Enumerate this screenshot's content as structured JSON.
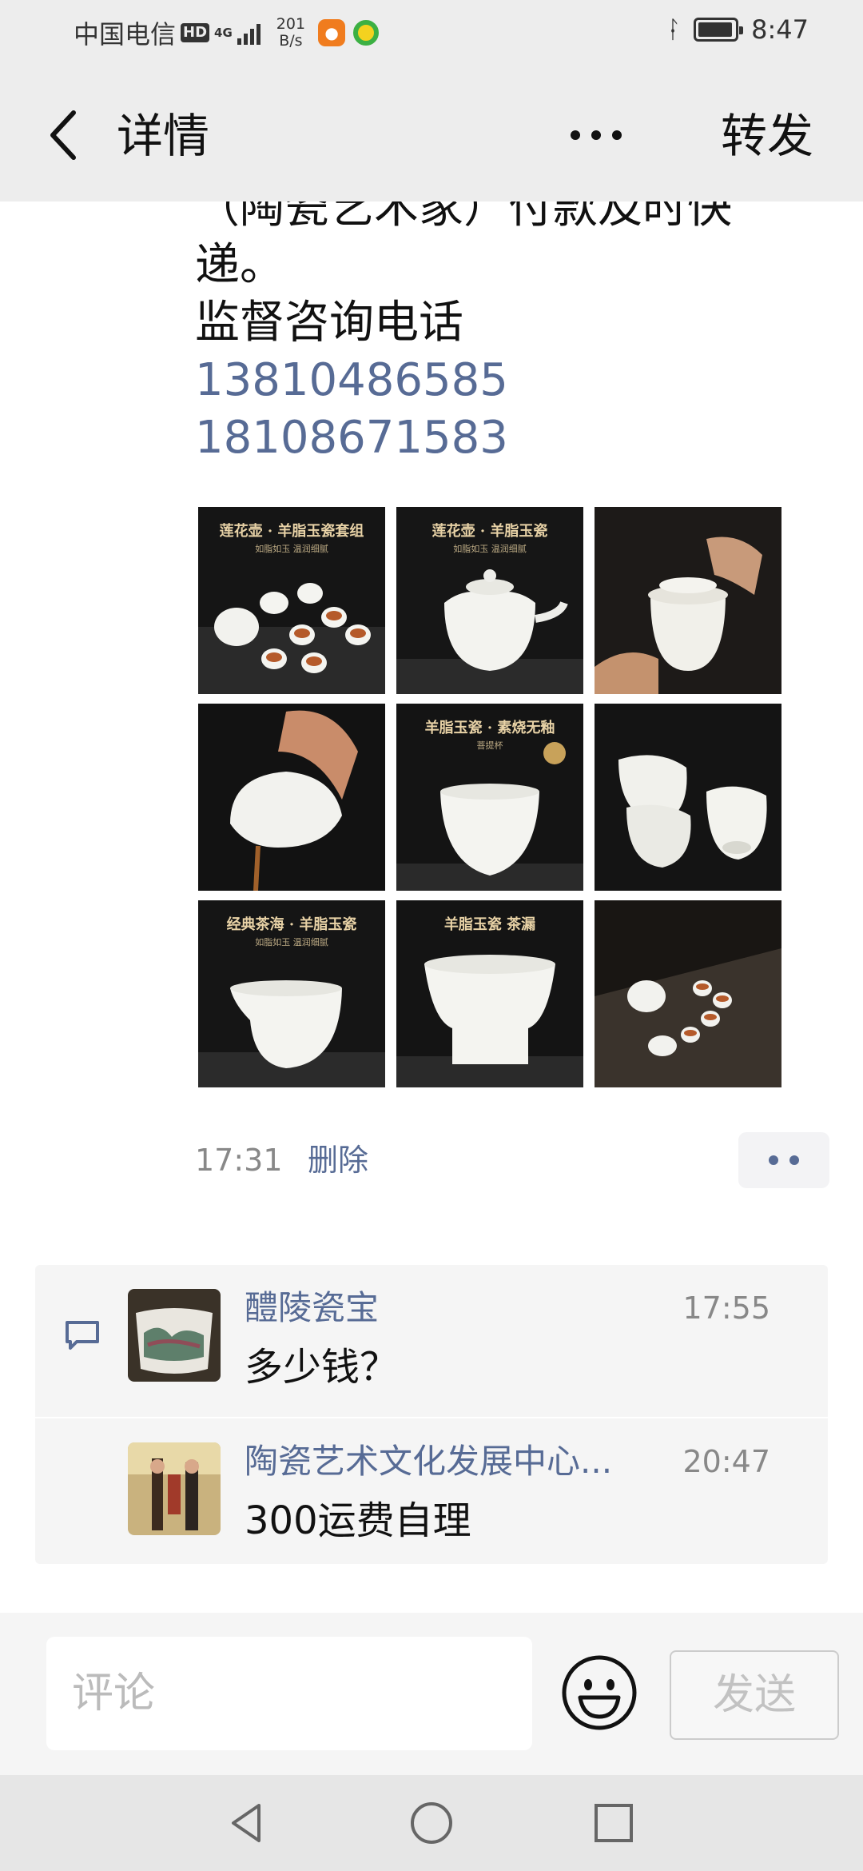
{
  "status_bar": {
    "carrier": "中国电信",
    "hd": "HD",
    "network": "4G",
    "speed_value": "201",
    "speed_unit": "B/s",
    "time": "8:47"
  },
  "nav": {
    "back_icon": "chevron-left-icon",
    "title": "详情",
    "more_icon": "more-dots-icon",
    "forward": "转发"
  },
  "post": {
    "text_cut": "（陶瓷艺术家）付款及时快",
    "text_line": "递。",
    "supervise": "监督咨询电话",
    "phones": [
      "13810486585",
      "18108671583"
    ],
    "images": [
      {
        "label": "莲花壶 · 羊脂玉瓷套组",
        "sub": "如脂如玉 温润细腻"
      },
      {
        "label": "莲花壶 · 羊脂玉瓷",
        "sub": "如脂如玉 温润细腻"
      },
      {
        "label": "",
        "sub": ""
      },
      {
        "label": "",
        "sub": ""
      },
      {
        "label": "羊脂玉瓷 · 素烧无釉",
        "sub": "菩提杯"
      },
      {
        "label": "",
        "sub": ""
      },
      {
        "label": "经典茶海 · 羊脂玉瓷",
        "sub": "如脂如玉 温润细腻"
      },
      {
        "label": "羊脂玉瓷 茶漏",
        "sub": ""
      },
      {
        "label": "",
        "sub": ""
      }
    ],
    "time": "17:31",
    "delete": "删除"
  },
  "comments": [
    {
      "name": "醴陵瓷宝",
      "time": "17:55",
      "text": "多少钱？"
    },
    {
      "name": "陶瓷艺术文化发展中心...",
      "time": "20:47",
      "text": "300运费自理"
    }
  ],
  "input": {
    "placeholder": "评论",
    "emoji_icon": "smiley-icon",
    "send": "发送"
  },
  "colors": {
    "link": "#576b95",
    "bar_bg": "#ededed"
  }
}
